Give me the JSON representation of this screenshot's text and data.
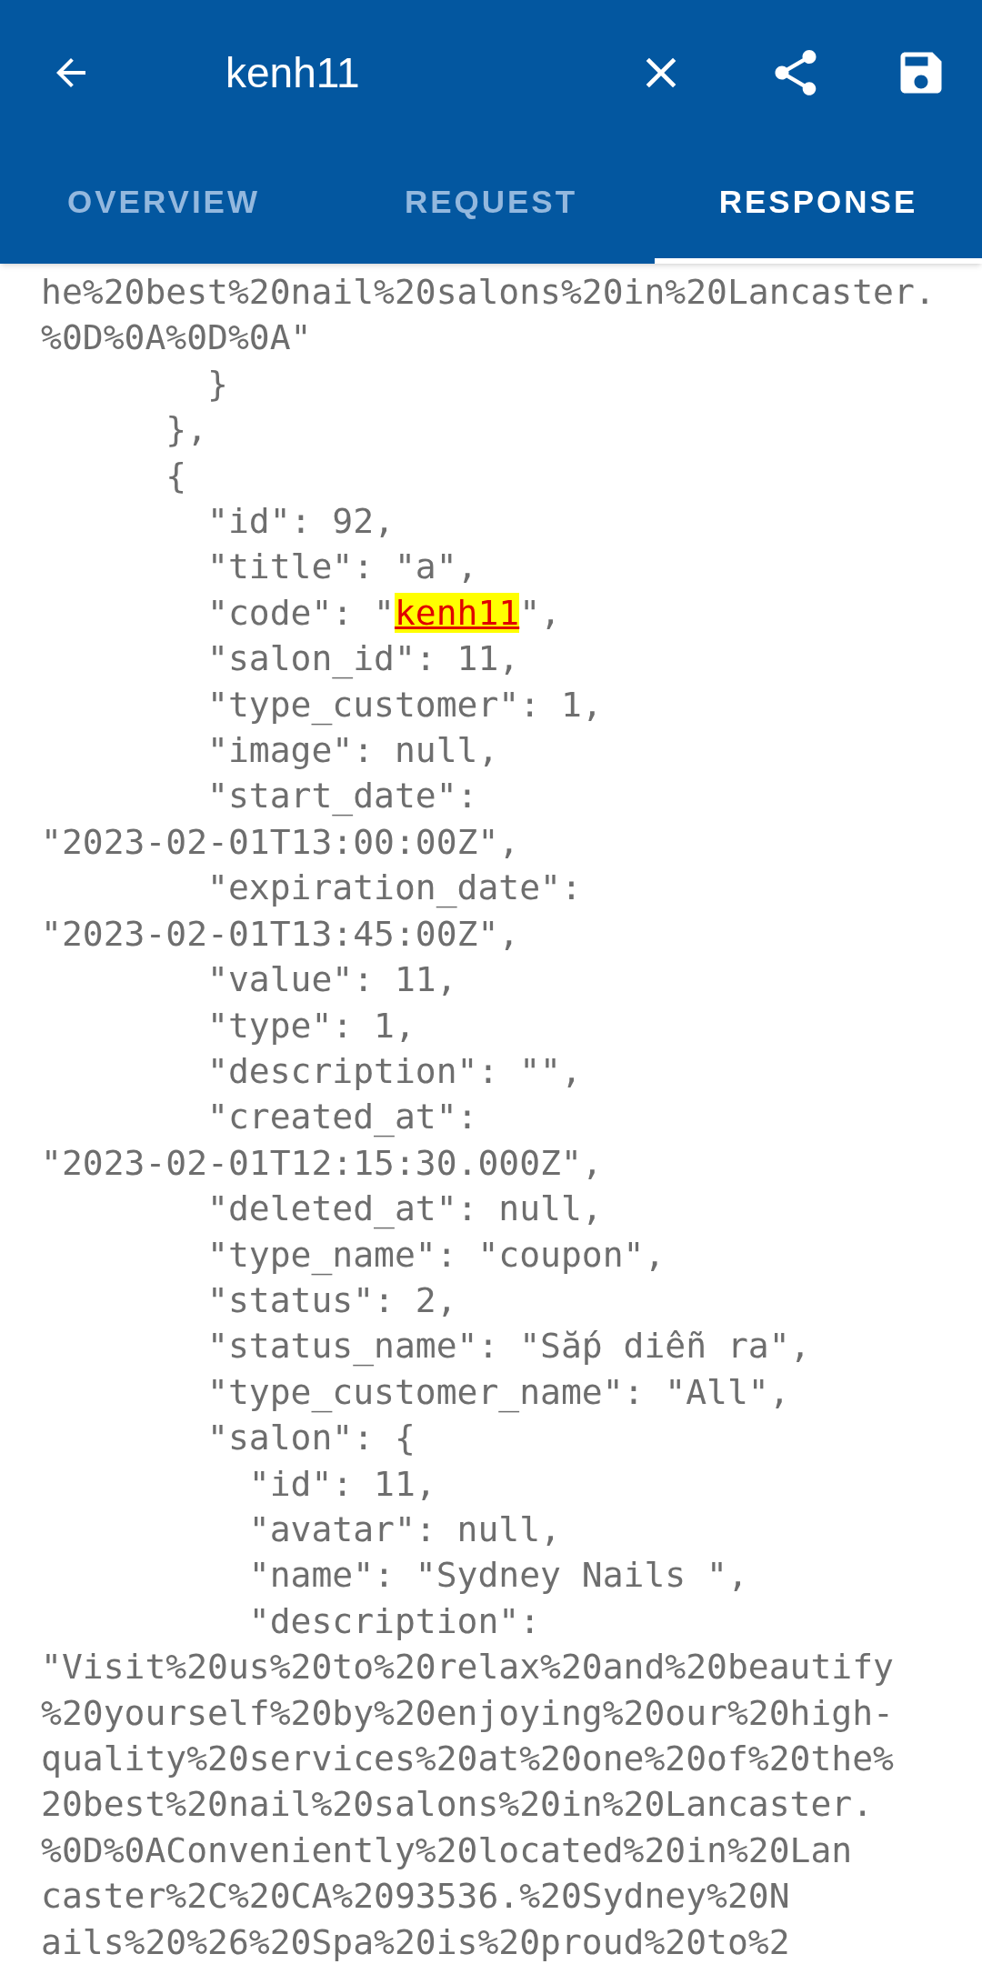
{
  "toolbar": {
    "title": "kenh11"
  },
  "tabs": [
    {
      "label": "OVERVIEW",
      "selected": false
    },
    {
      "label": "REQUEST",
      "selected": false
    },
    {
      "label": "RESPONSE",
      "selected": true
    }
  ],
  "lines": [
    {
      "text": "he%20best%20nail%20salons%20in%20Lancaster."
    },
    {
      "text": "%0D%0A%0D%0A\""
    },
    {
      "text": "        }"
    },
    {
      "text": "      },"
    },
    {
      "text": "      {"
    },
    {
      "text": "        \"id\": 92,"
    },
    {
      "text": "        \"title\": \"a\","
    },
    {
      "parts": [
        {
          "text": "        \"code\": \"",
          "highlighted": false
        },
        {
          "text": "kenh11",
          "highlighted": true
        },
        {
          "text": "\",",
          "highlighted": false
        }
      ]
    },
    {
      "text": "        \"salon_id\": 11,"
    },
    {
      "text": "        \"type_customer\": 1,"
    },
    {
      "text": "        \"image\": null,"
    },
    {
      "text": "        \"start_date\":"
    },
    {
      "text": "\"2023-02-01T13:00:00Z\","
    },
    {
      "text": "        \"expiration_date\":"
    },
    {
      "text": "\"2023-02-01T13:45:00Z\","
    },
    {
      "text": "        \"value\": 11,"
    },
    {
      "text": "        \"type\": 1,"
    },
    {
      "text": "        \"description\": \"\","
    },
    {
      "text": "        \"created_at\":"
    },
    {
      "text": "\"2023-02-01T12:15:30.000Z\","
    },
    {
      "text": "        \"deleted_at\": null,"
    },
    {
      "text": "        \"type_name\": \"coupon\","
    },
    {
      "text": "        \"status\": 2,"
    },
    {
      "text": "        \"status_name\": \"Sắp diễn ra\","
    },
    {
      "text": "        \"type_customer_name\": \"All\","
    },
    {
      "text": "        \"salon\": {"
    },
    {
      "text": "          \"id\": 11,"
    },
    {
      "text": "          \"avatar\": null,"
    },
    {
      "text": "          \"name\": \"Sydney Nails \","
    },
    {
      "text": "          \"description\":"
    },
    {
      "text": "\"Visit%20us%20to%20relax%20and%20beautify"
    },
    {
      "text": "%20yourself%20by%20enjoying%20our%20high-"
    },
    {
      "text": "quality%20services%20at%20one%20of%20the%"
    },
    {
      "text": "20best%20nail%20salons%20in%20Lancaster."
    },
    {
      "text": "%0D%0AConveniently%20located%20in%20Lan"
    },
    {
      "text": "caster%2C%20CA%2093536.%20Sydney%20N"
    },
    {
      "text": "ails%20%26%20Spa%20is%20proud%20to%2"
    }
  ]
}
